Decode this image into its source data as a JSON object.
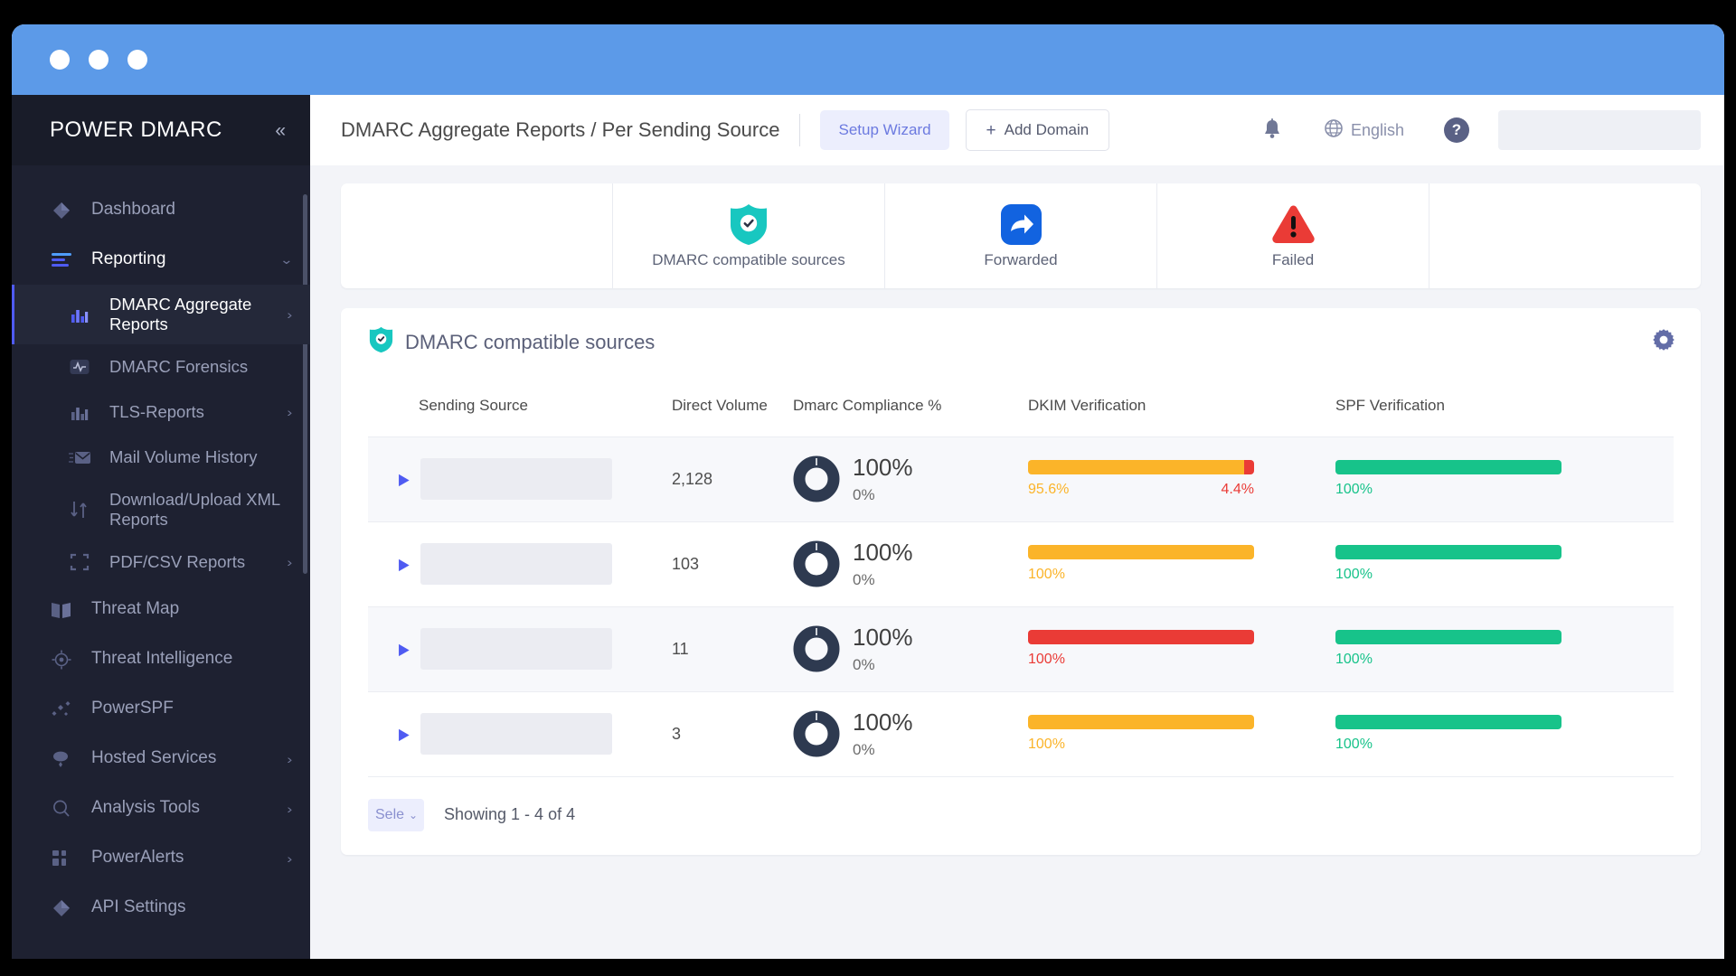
{
  "window": {
    "traffic_dots": [
      "close",
      "minimize",
      "maximize"
    ]
  },
  "sidebar": {
    "brand_prefix": "POW",
    "brand_mid": "ER ",
    "brand_suffix": "DMARC",
    "brand_full": "POWER DMARC",
    "collapse_icon": "chevrons-left-icon",
    "items": [
      {
        "label": "Dashboard",
        "icon": "diamond-icon",
        "level": "top",
        "state": "normal",
        "chevron": ""
      },
      {
        "label": "Reporting",
        "icon": "list-lines-icon",
        "level": "top",
        "state": "active-parent",
        "chevron": "⌄"
      },
      {
        "label": "DMARC Aggregate Reports",
        "icon": "bar-chart-icon",
        "level": "sub",
        "state": "active-sub",
        "chevron": "›"
      },
      {
        "label": "DMARC Forensics",
        "icon": "pulse-icon",
        "level": "sub",
        "state": "normal",
        "chevron": ""
      },
      {
        "label": "TLS-Reports",
        "icon": "bar-chart-icon",
        "level": "sub",
        "state": "normal",
        "chevron": "›"
      },
      {
        "label": "Mail Volume History",
        "icon": "envelope-icon",
        "level": "sub",
        "state": "normal",
        "chevron": ""
      },
      {
        "label": "Download/Upload XML Reports",
        "icon": "down-up-arrows-icon",
        "level": "sub",
        "state": "normal",
        "chevron": ""
      },
      {
        "label": "PDF/CSV Reports",
        "icon": "frame-icon",
        "level": "sub",
        "state": "normal",
        "chevron": "›"
      },
      {
        "label": "Threat Map",
        "icon": "book-icon",
        "level": "top",
        "state": "normal",
        "chevron": ""
      },
      {
        "label": "Threat Intelligence",
        "icon": "target-icon",
        "level": "top",
        "state": "normal",
        "chevron": ""
      },
      {
        "label": "PowerSPF",
        "icon": "nodes-icon",
        "level": "top",
        "state": "normal",
        "chevron": ""
      },
      {
        "label": "Hosted Services",
        "icon": "cloud-icon",
        "level": "top",
        "state": "normal",
        "chevron": "›"
      },
      {
        "label": "Analysis Tools",
        "icon": "search-circle-icon",
        "level": "top",
        "state": "normal",
        "chevron": "›"
      },
      {
        "label": "PowerAlerts",
        "icon": "grid-icon",
        "level": "top",
        "state": "normal",
        "chevron": "›"
      },
      {
        "label": "API Settings",
        "icon": "diamond-icon",
        "level": "top",
        "state": "normal",
        "chevron": ""
      }
    ]
  },
  "topbar": {
    "breadcrumb": "DMARC Aggregate Reports / Per Sending Source",
    "setup_wizard_label": "Setup Wizard",
    "add_domain_label": "Add Domain",
    "add_domain_plus": "+",
    "bell_icon": "bell-icon",
    "language_label": "English",
    "globe_icon": "globe-icon",
    "help_label": "?",
    "search_placeholder": ""
  },
  "summary": {
    "cells": [
      {
        "label": "",
        "icon": ""
      },
      {
        "label": "DMARC compatible sources",
        "icon": "shield-check-icon"
      },
      {
        "label": "Forwarded",
        "icon": "forward-arrow-icon"
      },
      {
        "label": "Failed",
        "icon": "warning-triangle-icon"
      },
      {
        "label": "",
        "icon": ""
      }
    ]
  },
  "panel": {
    "title": "DMARC compatible sources",
    "title_icon": "shield-check-icon",
    "gear_icon": "gear-icon",
    "columns": [
      "",
      "Sending Source",
      "Direct Volume",
      "Dmarc Compliance %",
      "DKIM Verification",
      "SPF Verification"
    ],
    "rows": [
      {
        "expand_icon": "caret-right-icon",
        "sending_source": "",
        "direct_volume": "2,128",
        "dmarc_pass": "100%",
        "dmarc_fail": "0%",
        "dkim": [
          {
            "value": "95.6%",
            "pct": 95.6,
            "color": "#FBB429"
          },
          {
            "value": "4.4%",
            "pct": 4.4,
            "color": "#EA3B36"
          }
        ],
        "spf": [
          {
            "value": "100%",
            "pct": 100,
            "color": "#17C38A"
          }
        ]
      },
      {
        "expand_icon": "caret-right-icon",
        "sending_source": "",
        "direct_volume": "103",
        "dmarc_pass": "100%",
        "dmarc_fail": "0%",
        "dkim": [
          {
            "value": "100%",
            "pct": 100,
            "color": "#FBB429"
          }
        ],
        "spf": [
          {
            "value": "100%",
            "pct": 100,
            "color": "#17C38A"
          }
        ]
      },
      {
        "expand_icon": "caret-right-icon",
        "sending_source": "",
        "direct_volume": "11",
        "dmarc_pass": "100%",
        "dmarc_fail": "0%",
        "dkim": [
          {
            "value": "100%",
            "pct": 100,
            "color": "#EA3B36"
          }
        ],
        "spf": [
          {
            "value": "100%",
            "pct": 100,
            "color": "#17C38A"
          }
        ]
      },
      {
        "expand_icon": "caret-right-icon",
        "sending_source": "",
        "direct_volume": "3",
        "dmarc_pass": "100%",
        "dmarc_fail": "0%",
        "dkim": [
          {
            "value": "100%",
            "pct": 100,
            "color": "#FBB429"
          }
        ],
        "spf": [
          {
            "value": "100%",
            "pct": 100,
            "color": "#17C38A"
          }
        ]
      }
    ],
    "footer": {
      "rows_select_value": "Sele",
      "rows_select_caret": "⌄",
      "showing_text": "Showing 1 - 4 of 4"
    }
  },
  "colors": {
    "titlebar": "#5C9AE8",
    "sidebar": "#1E2131",
    "accent_indigo": "#4F5BF2",
    "teal": "#18C7C0",
    "blue": "#1263E0",
    "red": "#EA3B36",
    "amber": "#FBB429",
    "green": "#17C38A",
    "donut_navy": "#2E3A50"
  }
}
